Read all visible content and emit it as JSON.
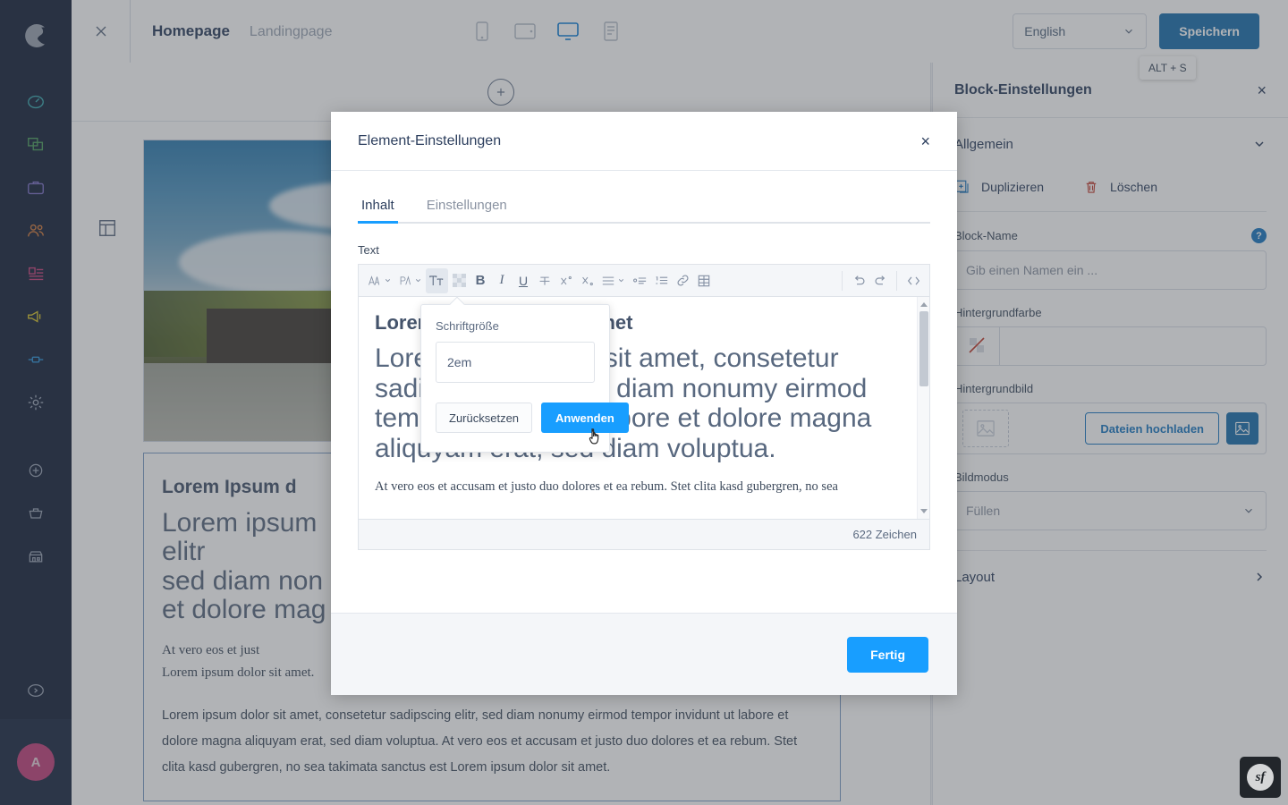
{
  "app": {
    "brand": "shopware",
    "avatar_initial": "A"
  },
  "sidebar": {
    "items": [
      {
        "name": "dashboard",
        "color": "#37a8ae"
      },
      {
        "name": "catalogues",
        "color": "#4a9c5c"
      },
      {
        "name": "orders",
        "color": "#7a6ec4"
      },
      {
        "name": "customers",
        "color": "#d1793a"
      },
      {
        "name": "content",
        "color": "#c7407a"
      },
      {
        "name": "marketing",
        "color": "#d6c229"
      },
      {
        "name": "extensions",
        "color": "#2a8fd4"
      },
      {
        "name": "settings",
        "color": "#98a2b3"
      },
      {
        "name": "add",
        "color": "#98a2b3"
      },
      {
        "name": "sales-channel-basket",
        "color": "#98a2b3"
      },
      {
        "name": "storefront",
        "color": "#98a2b3"
      }
    ],
    "help_label": "help",
    "avatar_label": "A"
  },
  "topbar": {
    "close_label": "×",
    "breadcrumb": {
      "active": "Homepage",
      "next": "Landingpage"
    },
    "devices": [
      {
        "name": "mobile",
        "active": false
      },
      {
        "name": "tablet",
        "active": false
      },
      {
        "name": "desktop",
        "active": true
      },
      {
        "name": "form",
        "active": false
      }
    ],
    "language": "English",
    "save_label": "Speichern",
    "save_tooltip": "ALT + S"
  },
  "stage": {
    "add_block_label": "+",
    "section_icon": "layout-icon",
    "card": {
      "heading": "Lorem Ipsum d",
      "big_text": "Lorem ipsum\nelitr\nsed diam non\net dolore mag",
      "serif_line_1": "At vero eos et just",
      "serif_line_2": "Lorem ipsum dolor sit amet.",
      "paragraph": "Lorem ipsum dolor sit amet, consetetur sadipscing elitr, sed diam nonumy eirmod tempor invidunt ut labore et dolore magna aliquyam erat, sed diam voluptua. At vero eos et accusam et justo duo dolores et ea rebum. Stet clita kasd gubergren, no sea takimata sanctus est Lorem ipsum dolor sit amet."
    }
  },
  "right_panel": {
    "title": "Block-Einstellungen",
    "close_label": "×",
    "general_section": "Allgemein",
    "duplicate_label": "Duplizieren",
    "delete_label": "Löschen",
    "block_name_label": "Block-Name",
    "block_name_help": "?",
    "block_name_placeholder": "Gib einen Namen ein ...",
    "bg_color_label": "Hintergrundfarbe",
    "bg_color_value": "",
    "bg_image_label": "Hintergrundbild",
    "upload_label": "Dateien hochladen",
    "image_mode_label": "Bildmodus",
    "image_mode_value": "Füllen",
    "layout_section": "Layout"
  },
  "modal": {
    "title": "Element-Einstellungen",
    "close_label": "×",
    "tabs": [
      {
        "label": "Inhalt",
        "active": true
      },
      {
        "label": "Einstellungen",
        "active": false
      }
    ],
    "text_field_label": "Text",
    "toolbar": [
      {
        "name": "font-family-icon",
        "glyph": "A",
        "chevron": true,
        "active": false
      },
      {
        "name": "font-weight-icon",
        "glyph": "A",
        "chevron": true,
        "active": false
      },
      {
        "name": "font-size-icon",
        "glyph": "Tт",
        "chevron": false,
        "active": true
      },
      {
        "name": "text-color-icon",
        "glyph": "",
        "chevron": false,
        "active": false
      },
      {
        "name": "bold-icon",
        "glyph": "B",
        "chevron": false,
        "active": false
      },
      {
        "name": "italic-icon",
        "glyph": "I",
        "chevron": false,
        "active": false
      },
      {
        "name": "underline-icon",
        "glyph": "U",
        "chevron": false,
        "active": false
      },
      {
        "name": "strikethrough-icon",
        "glyph": "T",
        "chevron": false,
        "active": false
      },
      {
        "name": "superscript-icon",
        "glyph": "X",
        "chevron": false,
        "active": false
      },
      {
        "name": "subscript-icon",
        "glyph": "X",
        "chevron": false,
        "active": false
      },
      {
        "name": "align-icon",
        "glyph": "≡",
        "chevron": true,
        "active": false
      },
      {
        "name": "bullet-list-icon",
        "glyph": "",
        "chevron": false,
        "active": false
      },
      {
        "name": "numbered-list-icon",
        "glyph": "",
        "chevron": false,
        "active": false
      },
      {
        "name": "link-icon",
        "glyph": "",
        "chevron": false,
        "active": false
      },
      {
        "name": "table-icon",
        "glyph": "",
        "chevron": false,
        "active": false
      },
      {
        "name": "undo-icon",
        "glyph": "",
        "chevron": false,
        "active": false
      },
      {
        "name": "redo-icon",
        "glyph": "",
        "chevron": false,
        "active": false
      },
      {
        "name": "source-code-icon",
        "glyph": "",
        "chevron": false,
        "active": false
      }
    ],
    "editor": {
      "heading": "Lorem ipsum dolor sit amet",
      "big_paragraph": "Lorem ipsum dolor sit amet, consetetur sadipscing elitr, sed diam nonumy eirmod tempor invidunt ut labore et dolore magna aliquyam erat, sed diam voluptua.",
      "small_paragraph": "At vero eos et accusam et justo duo dolores et ea rebum. Stet clita kasd gubergren, no sea",
      "char_count": "622 Zeichen"
    },
    "done_label": "Fertig"
  },
  "popover": {
    "label": "Schriftgröße",
    "value": "2em",
    "reset_label": "Zurücksetzen",
    "apply_label": "Anwenden"
  },
  "profiler": {
    "badge": "sf"
  },
  "colors": {
    "brand_dark": "#16223a",
    "primary_blue": "#1a6ead",
    "accent_blue": "#189eff",
    "avatar_pink": "#bf417a"
  }
}
